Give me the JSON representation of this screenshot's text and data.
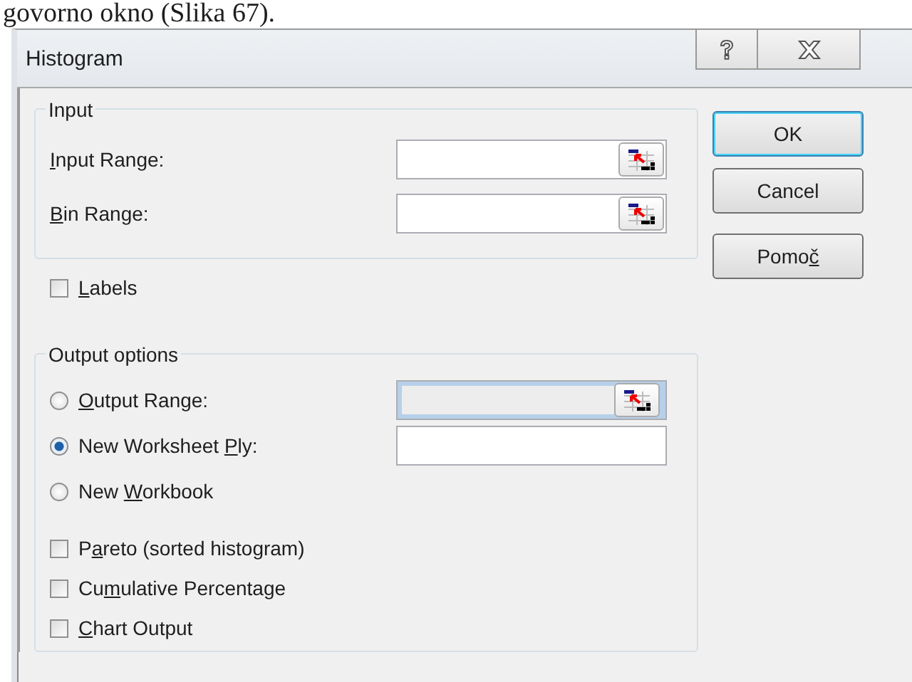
{
  "document_text": "govorno okno (Slika 67).",
  "window": {
    "title": "Histogram"
  },
  "input_group": {
    "legend": "Input",
    "rows": [
      {
        "label": [
          {
            "text": "I",
            "underline": true
          },
          {
            "text": "nput Range:"
          }
        ],
        "field": {
          "picker": true,
          "disabled": false
        }
      },
      {
        "label": [
          {
            "text": "B",
            "underline": true
          },
          {
            "text": "in Range:"
          }
        ],
        "field": {
          "picker": true,
          "disabled": false
        }
      }
    ]
  },
  "labels_checkbox": {
    "label": [
      {
        "text": "L",
        "underline": true
      },
      {
        "text": "abels"
      }
    ],
    "checked": false
  },
  "output_group": {
    "legend": "Output options",
    "radios": [
      {
        "label": [
          {
            "text": "O",
            "underline": true
          },
          {
            "text": "utput Range:"
          }
        ],
        "selected": false,
        "field": {
          "picker": true,
          "disabled": true
        }
      },
      {
        "label": [
          {
            "text": "New Worksheet "
          },
          {
            "text": "P",
            "underline": true
          },
          {
            "text": "ly:"
          }
        ],
        "selected": true,
        "field": {
          "picker": false,
          "disabled": false
        }
      },
      {
        "label": [
          {
            "text": "New "
          },
          {
            "text": "W",
            "underline": true
          },
          {
            "text": "orkbook"
          }
        ],
        "selected": false
      }
    ],
    "checkboxes": [
      {
        "label": [
          {
            "text": "P"
          },
          {
            "text": "a",
            "underline": true
          },
          {
            "text": "reto (sorted histogram)"
          }
        ],
        "checked": false
      },
      {
        "label": [
          {
            "text": "Cu"
          },
          {
            "text": "m",
            "underline": true
          },
          {
            "text": "ulative Percentage"
          }
        ],
        "checked": false
      },
      {
        "label": [
          {
            "text": "C",
            "underline": true
          },
          {
            "text": "hart Output"
          }
        ],
        "checked": false
      }
    ]
  },
  "buttons": [
    {
      "label": [
        {
          "text": "OK"
        }
      ],
      "default": true
    },
    {
      "label": [
        {
          "text": "Cancel"
        }
      ],
      "default": false
    },
    {
      "label": [
        {
          "text": "Pomo"
        },
        {
          "text": "č",
          "underline": true
        }
      ],
      "default": false
    }
  ]
}
